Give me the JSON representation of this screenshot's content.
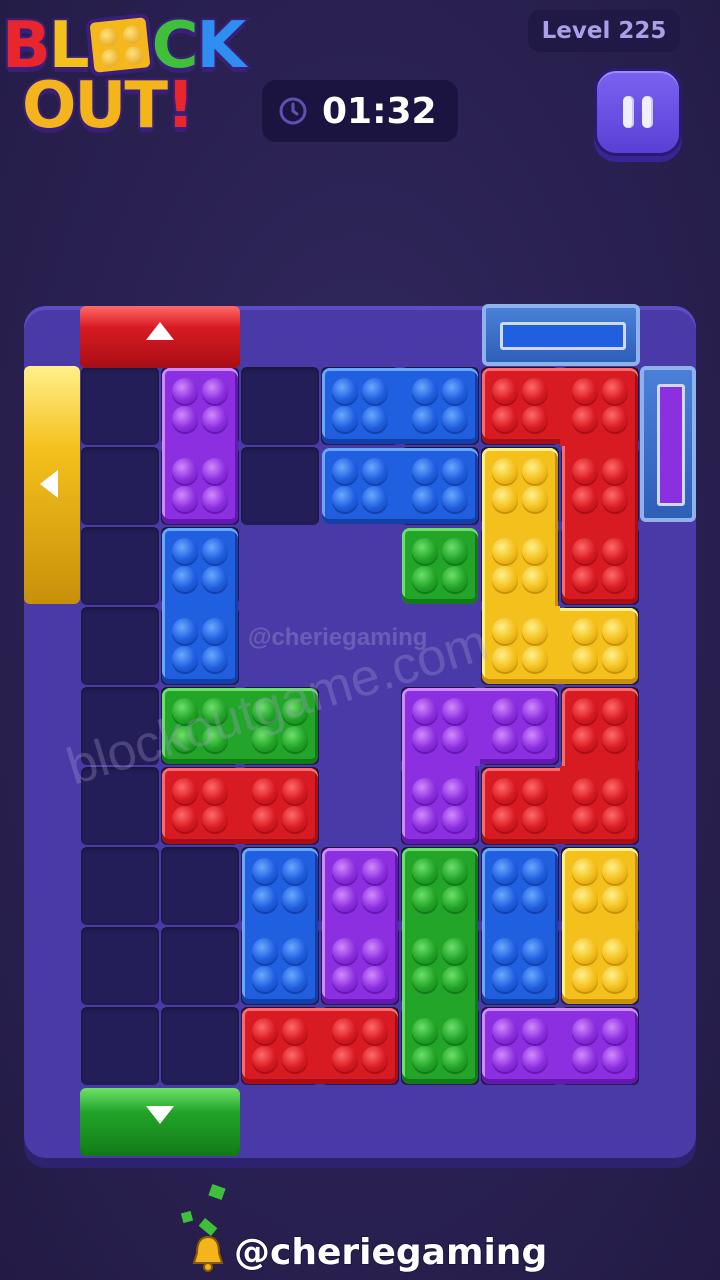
{
  "header": {
    "logo_line1": [
      "B",
      "L",
      "",
      "C",
      "K"
    ],
    "logo_line2": [
      "O",
      "U",
      "T",
      "!"
    ],
    "level": "Level 225",
    "timer": "01:32",
    "icons": {
      "timer": "clock-icon",
      "pause": "pause-icon"
    }
  },
  "colors": {
    "red": "#e0202a",
    "blue": "#1f5fe0",
    "green": "#22a528",
    "yellow": "#f4c01c",
    "purple": "#8c2fe0",
    "board": "#4a3aa8",
    "cell": "#241e58"
  },
  "board": {
    "columns": 7,
    "rows": 9,
    "plus_hole_cells": [
      [
        2,
        2
      ],
      [
        3,
        2
      ],
      [
        4,
        2
      ],
      [
        3,
        1
      ],
      [
        3,
        3
      ],
      [
        2,
        3
      ],
      [
        4,
        3
      ],
      [
        3,
        4
      ],
      [
        3,
        5
      ]
    ],
    "gates": [
      {
        "name": "gate-top-red",
        "color": "red",
        "side": "top",
        "arrow": "up"
      },
      {
        "name": "gate-top-blue-locked",
        "color": "blue",
        "side": "top",
        "arrow": "locked"
      },
      {
        "name": "gate-left-yellow",
        "color": "yellow",
        "side": "left",
        "arrow": "left"
      },
      {
        "name": "gate-right-purple-locked",
        "color": "purple",
        "side": "right",
        "arrow": "locked"
      },
      {
        "name": "gate-bottom-green",
        "color": "green",
        "side": "bottom",
        "arrow": "down"
      }
    ],
    "blocks": [
      {
        "name": "block-purple-1",
        "color": "purple",
        "cells": [
          [
            1,
            0
          ],
          [
            1,
            1
          ]
        ]
      },
      {
        "name": "block-blue-1",
        "color": "blue",
        "cells": [
          [
            3,
            0
          ],
          [
            4,
            0
          ]
        ]
      },
      {
        "name": "block-blue-2",
        "color": "blue",
        "cells": [
          [
            3,
            1
          ],
          [
            4,
            1
          ]
        ]
      },
      {
        "name": "block-red-l",
        "color": "red",
        "cells": [
          [
            5,
            0
          ],
          [
            6,
            0
          ],
          [
            6,
            1
          ],
          [
            6,
            2
          ]
        ]
      },
      {
        "name": "block-blue-3",
        "color": "blue",
        "cells": [
          [
            1,
            2
          ],
          [
            1,
            3
          ]
        ]
      },
      {
        "name": "block-green-1",
        "color": "green",
        "cells": [
          [
            4,
            2
          ]
        ]
      },
      {
        "name": "block-yellow-l",
        "color": "yellow",
        "cells": [
          [
            5,
            1
          ],
          [
            5,
            2
          ],
          [
            5,
            3
          ],
          [
            6,
            3
          ]
        ]
      },
      {
        "name": "block-green-2",
        "color": "green",
        "cells": [
          [
            1,
            4
          ],
          [
            2,
            4
          ]
        ]
      },
      {
        "name": "block-purple-l",
        "color": "purple",
        "cells": [
          [
            4,
            4
          ],
          [
            5,
            4
          ],
          [
            4,
            5
          ]
        ]
      },
      {
        "name": "block-red-2",
        "color": "red",
        "cells": [
          [
            6,
            4
          ],
          [
            5,
            5
          ],
          [
            6,
            5
          ]
        ]
      },
      {
        "name": "block-red-3",
        "color": "red",
        "cells": [
          [
            1,
            5
          ],
          [
            2,
            5
          ]
        ]
      },
      {
        "name": "block-blue-4",
        "color": "blue",
        "cells": [
          [
            2,
            6
          ],
          [
            2,
            7
          ]
        ]
      },
      {
        "name": "block-purple-2",
        "color": "purple",
        "cells": [
          [
            3,
            6
          ],
          [
            3,
            7
          ]
        ]
      },
      {
        "name": "block-green-3",
        "color": "green",
        "cells": [
          [
            4,
            6
          ],
          [
            4,
            7
          ],
          [
            4,
            8
          ]
        ]
      },
      {
        "name": "block-blue-5",
        "color": "blue",
        "cells": [
          [
            5,
            6
          ],
          [
            5,
            7
          ]
        ]
      },
      {
        "name": "block-yellow-2",
        "color": "yellow",
        "cells": [
          [
            6,
            6
          ],
          [
            6,
            7
          ]
        ]
      },
      {
        "name": "block-red-4",
        "color": "red",
        "cells": [
          [
            2,
            8
          ],
          [
            3,
            8
          ]
        ]
      },
      {
        "name": "block-purple-3",
        "color": "purple",
        "cells": [
          [
            5,
            8
          ],
          [
            6,
            8
          ]
        ]
      }
    ]
  },
  "watermarks": {
    "main": "blockoutgame.com",
    "board": "@cheriegaming"
  },
  "credit": {
    "handle": "@cheriegaming",
    "icon": "bell-icon"
  }
}
